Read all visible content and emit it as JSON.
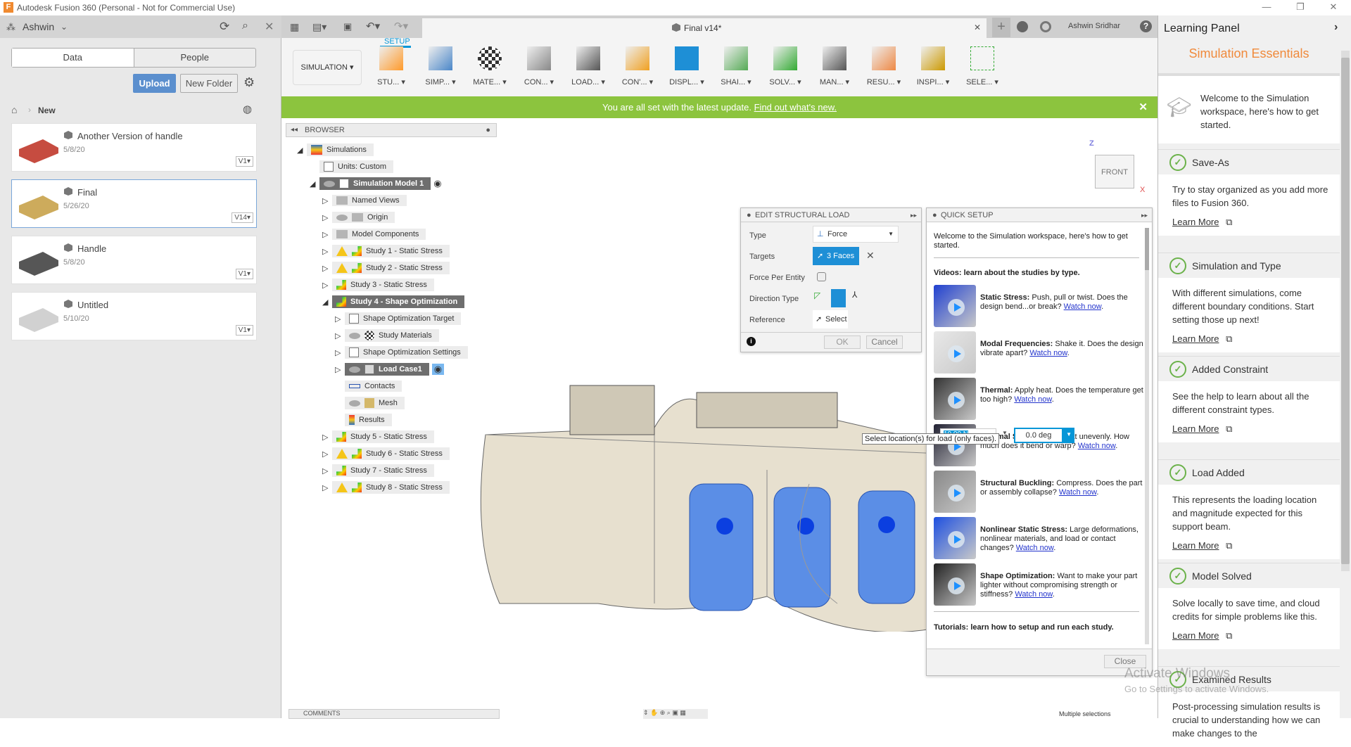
{
  "window": {
    "title": "Autodesk Fusion 360 (Personal - Not for Commercial Use)",
    "minimize": "—",
    "restore": "❐",
    "close": "✕"
  },
  "data_panel": {
    "user": "Ashwin",
    "tabs": [
      "Data",
      "People"
    ],
    "upload": "Upload",
    "new_folder": "New Folder",
    "breadcrumb": "New",
    "files": [
      {
        "name": "Another Version of handle",
        "date": "5/8/20",
        "version": "V1▾",
        "color": "#c0392b"
      },
      {
        "name": "Final",
        "date": "5/26/20",
        "version": "V14▾",
        "color": "#c8a24a"
      },
      {
        "name": "Handle",
        "date": "5/8/20",
        "version": "V1▾",
        "color": "#444444"
      },
      {
        "name": "Untitled",
        "date": "5/10/20",
        "version": "V1▾",
        "color": "#cccccc"
      }
    ]
  },
  "tabbar": {
    "doc_title": "Final v14*",
    "user": "Ashwin Sridhar",
    "close": "✕",
    "plus": "+",
    "help": "?"
  },
  "toolbar": {
    "workspace": "SIMULATION ▾",
    "tab": "SETUP",
    "tools": [
      {
        "label": "STU... ▾",
        "icon": "study-icon"
      },
      {
        "label": "SIMP... ▾",
        "icon": "simplify-icon"
      },
      {
        "label": "MATE... ▾",
        "icon": "materials-icon"
      },
      {
        "label": "CON... ▾",
        "icon": "constraints-icon"
      },
      {
        "label": "LOAD... ▾",
        "icon": "loads-icon"
      },
      {
        "label": "CON'... ▾",
        "icon": "contacts-icon"
      },
      {
        "label": "DISPL... ▾",
        "icon": "display-icon"
      },
      {
        "label": "SHAI... ▾",
        "icon": "shape-icon"
      },
      {
        "label": "SOLV... ▾",
        "icon": "solve-icon"
      },
      {
        "label": "MAN... ▾",
        "icon": "manage-icon"
      },
      {
        "label": "RESU... ▾",
        "icon": "results-icon"
      },
      {
        "label": "INSPI... ▾",
        "icon": "inspect-icon"
      },
      {
        "label": "SELE... ▾",
        "icon": "select-icon"
      }
    ]
  },
  "banner": {
    "text": "You are all set with the latest update.",
    "link": "Find out what's new.",
    "close": "✕"
  },
  "browser": {
    "title": "BROWSER",
    "items": [
      {
        "label": "Simulations",
        "level": 0,
        "exp": "open",
        "icon": "simulations"
      },
      {
        "label": "Units: Custom",
        "level": 1,
        "exp": "none",
        "icon": "doc"
      },
      {
        "label": "Simulation Model 1",
        "level": 1,
        "exp": "open",
        "icon": "model",
        "eye": true,
        "hl": true,
        "radio": true
      },
      {
        "label": "Named Views",
        "level": 2,
        "exp": "closed",
        "icon": "folder"
      },
      {
        "label": "Origin",
        "level": 2,
        "exp": "closed",
        "icon": "folder",
        "eye": true
      },
      {
        "label": "Model Components",
        "level": 2,
        "exp": "closed",
        "icon": "folder"
      },
      {
        "label": "Study 1 - Static Stress",
        "level": 2,
        "exp": "closed",
        "icon": "study",
        "warn": true
      },
      {
        "label": "Study 2 - Static Stress",
        "level": 2,
        "exp": "closed",
        "icon": "study",
        "warn": true
      },
      {
        "label": "Study 3 - Static Stress",
        "level": 2,
        "exp": "closed",
        "icon": "study"
      },
      {
        "label": "Study 4 - Shape Optimization",
        "level": 2,
        "exp": "open",
        "icon": "study",
        "hl": true
      },
      {
        "label": "Shape Optimization Target",
        "level": 3,
        "exp": "closed",
        "icon": "doc"
      },
      {
        "label": "Study Materials",
        "level": 3,
        "exp": "closed",
        "icon": "materials",
        "eye": true
      },
      {
        "label": "Shape Optimization Settings",
        "level": 3,
        "exp": "closed",
        "icon": "doc"
      },
      {
        "label": "Load Case1",
        "level": 3,
        "exp": "closed",
        "icon": "load",
        "eye": true,
        "hl": true,
        "radio": true
      },
      {
        "label": "Contacts",
        "level": 3,
        "exp": "none",
        "icon": "contacts"
      },
      {
        "label": "Mesh",
        "level": 3,
        "exp": "none",
        "icon": "mesh",
        "eye": true
      },
      {
        "label": "Results",
        "level": 3,
        "exp": "none",
        "icon": "results"
      },
      {
        "label": "Study 5 - Static Stress",
        "level": 2,
        "exp": "closed",
        "icon": "study"
      },
      {
        "label": "Study 6 - Static Stress",
        "level": 2,
        "exp": "closed",
        "icon": "study",
        "warn": true
      },
      {
        "label": "Study 7 - Static Stress",
        "level": 2,
        "exp": "closed",
        "icon": "study"
      },
      {
        "label": "Study 8 - Static Stress",
        "level": 2,
        "exp": "closed",
        "icon": "study",
        "warn": true
      }
    ]
  },
  "viewcube": {
    "face": "FRONT",
    "z": "Z",
    "x": "X"
  },
  "edit_load": {
    "title": "EDIT STRUCTURAL LOAD",
    "type_label": "Type",
    "type_value": "Force",
    "targets_label": "Targets",
    "targets_value": "3 Faces",
    "per_entity_label": "Force Per Entity",
    "direction_label": "Direction Type",
    "reference_label": "Reference",
    "reference_value": "Select",
    "ok": "OK",
    "cancel": "Cancel"
  },
  "canvas": {
    "tooltip": "Select location(s) for load (only faces).",
    "angle": "0.0 deg",
    "force": "10.00 N"
  },
  "quick_setup": {
    "title": "QUICK SETUP",
    "intro": "Welcome to the Simulation workspace, here's how to get started.",
    "videos_heading": "Videos: learn about the studies by type.",
    "videos": [
      {
        "title": "Static Stress:",
        "text": "Push, pull or twist. Does the design bend...or break?",
        "link": "Watch now"
      },
      {
        "title": "Modal Frequencies:",
        "text": "Shake it. Does the design vibrate apart?",
        "link": "Watch now"
      },
      {
        "title": "Thermal:",
        "text": "Apply heat. Does the temperature get too high?",
        "link": "Watch now"
      },
      {
        "title": "Thermal Stress:",
        "text": "Apply heat unevenly. How much does it bend or warp?",
        "link": "Watch now"
      },
      {
        "title": "Structural Buckling:",
        "text": "Compress. Does the part or assembly collapse?",
        "link": "Watch now"
      },
      {
        "title": "Nonlinear Static Stress:",
        "text": "Large deformations, nonlinear materials, and load or contact changes?",
        "link": "Watch now"
      },
      {
        "title": "Shape Optimization:",
        "text": "Want to make your part lighter without compromising strength or stiffness?",
        "link": "Watch now"
      }
    ],
    "tutorials_heading": "Tutorials: learn how to setup and run each study.",
    "close": "Close"
  },
  "learning": {
    "title": "Learning Panel",
    "heading": "Simulation Essentials",
    "welcome": "Welcome to the Simulation workspace, here's how to get started.",
    "learn_more": "Learn More",
    "sections": [
      {
        "title": "Save-As",
        "body": "Try to stay organized as you add more files to Fusion 360."
      },
      {
        "title": "Simulation and Type",
        "body": "With different simulations, come different boundary conditions. Start setting those up next!"
      },
      {
        "title": "Added Constraint",
        "body": "See the help to learn about all the different constraint types."
      },
      {
        "title": "Load Added",
        "body": "This represents the loading location and magnitude expected for this support beam."
      },
      {
        "title": "Model Solved",
        "body": "Solve locally to save time, and cloud credits for simple problems like this."
      },
      {
        "title": "Examined Results",
        "body": "Post-processing simulation results is crucial to understanding how we can make changes to the"
      }
    ]
  },
  "bottom": {
    "comments": "COMMENTS",
    "status": "Multiple selections"
  },
  "watermark": {
    "line1": "Activate Windows",
    "line2": "Go to Settings to activate Windows."
  },
  "colors": {
    "accent": "#0696d7",
    "banner": "#8cc43e",
    "learning_heading": "#f08a3c",
    "check": "#6bb24a"
  }
}
